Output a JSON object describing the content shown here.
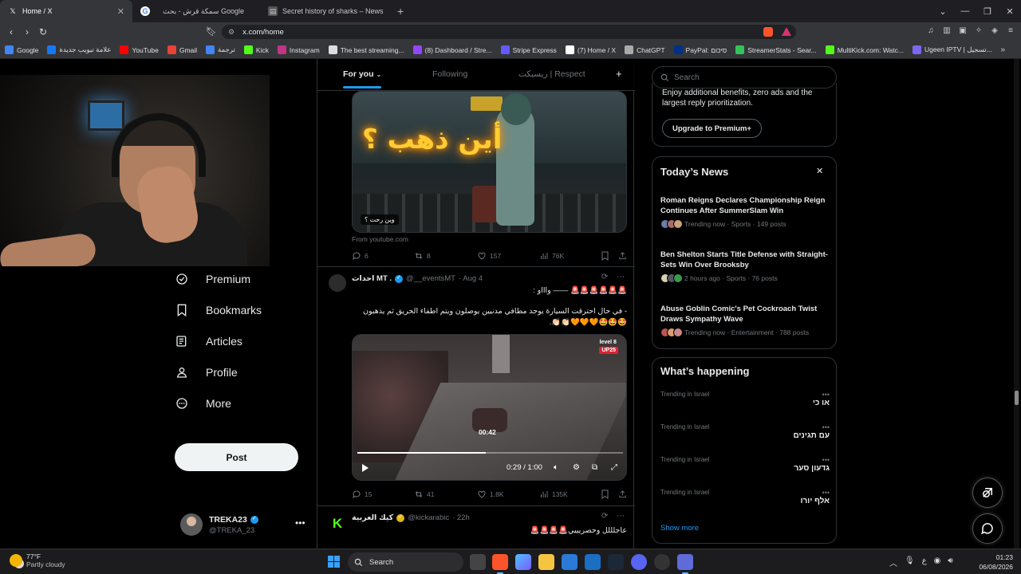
{
  "browser": {
    "tabs": [
      {
        "title": "Home / X",
        "active": true
      },
      {
        "title": "سمكة قرش - بحث Google",
        "active": false
      },
      {
        "title": "Secret history of sharks – News",
        "active": false
      }
    ],
    "url": "x.com/home",
    "bookmarks": [
      {
        "label": "Google",
        "color": "#4285f4"
      },
      {
        "label": "علامة تبويب جديدة",
        "color": "#1877f2"
      },
      {
        "label": "YouTube",
        "color": "#ff0000"
      },
      {
        "label": "Gmail",
        "color": "#ea4335"
      },
      {
        "label": "ترجمة",
        "color": "#4285f4"
      },
      {
        "label": "Kick",
        "color": "#53fc18"
      },
      {
        "label": "Instagram",
        "color": "#c13584"
      },
      {
        "label": "The best streaming...",
        "color": "#dddddd"
      },
      {
        "label": "(8) Dashboard / Stre...",
        "color": "#9147ff"
      },
      {
        "label": "Stripe Express",
        "color": "#635bff"
      },
      {
        "label": "(7) Home / X",
        "color": "#ffffff"
      },
      {
        "label": "ChatGPT",
        "color": "#aaaaaa"
      },
      {
        "label": "PayPal: סיכום",
        "color": "#003087"
      },
      {
        "label": "StreamerStats - Sear...",
        "color": "#36c25a"
      },
      {
        "label": "MultiKick.com: Watc...",
        "color": "#53fc18"
      },
      {
        "label": "Ugeen IPTV | تسجيل...",
        "color": "#7b68ee"
      }
    ]
  },
  "nav": {
    "items": [
      {
        "label": "Premium",
        "icon": "premium-icon"
      },
      {
        "label": "Bookmarks",
        "icon": "bookmark-icon"
      },
      {
        "label": "Articles",
        "icon": "articles-icon"
      },
      {
        "label": "Profile",
        "icon": "profile-icon"
      },
      {
        "label": "More",
        "icon": "more-icon"
      }
    ],
    "post_label": "Post",
    "account": {
      "name": "TREKA23",
      "handle": "@TREKA_23"
    }
  },
  "timeline": {
    "tabs": {
      "for_you": "For you",
      "following": "Following",
      "list": "ريسبكت | Respect"
    },
    "tweet1": {
      "media_text": "أين ذهب ؟",
      "media_caption": "وين رحت ؟",
      "source": "From youtube.com",
      "replies": "6",
      "reposts": "8",
      "likes": "157",
      "views": "76K"
    },
    "tweet2": {
      "name": "احداث MT .",
      "handle": "@__eventsMT",
      "date": "· Aug 4",
      "line1": "🚨🚨🚨🚨🚨🚨 —— واااو :",
      "line2": "- في حال احترقت السيارة يوجد مطافي مدنيين يوصلون ويتم اطفاء الحريق ثم يذهبون 🤩🤩🤩🧡🧡🧡👏🏻👏🏻.",
      "video_badge": "level 8",
      "video_badge2": "UP25",
      "video_timer": "00:42",
      "video_time": "0:29 / 1:00",
      "video_progress": 0.483,
      "replies": "15",
      "reposts": "41",
      "likes": "1.8K",
      "views": "135K"
    },
    "tweet3": {
      "name": "كيك العربية",
      "handle": "@kickarabic",
      "date": "· 22h",
      "text": "عاجلللل وحصريييي🚨🚨🚨🚨"
    }
  },
  "sidebar": {
    "search_placeholder": "Search",
    "premium": {
      "text": "Enjoy additional benefits, zero ads and the largest reply prioritization.",
      "button": "Upgrade to Premium+"
    },
    "news": {
      "title": "Today’s News",
      "items": [
        {
          "headline": "Roman Reigns Declares Championship Reign Continues After SummerSlam Win",
          "meta": "Trending now · Sports · 149 posts"
        },
        {
          "headline": "Ben Shelton Starts Title Defense with Straight-Sets Win Over Brooksby",
          "meta": "2 hours ago · Sports · 76 posts"
        },
        {
          "headline": "Abuse Goblin Comic's Pet Cockroach Twist Draws Sympathy Wave",
          "meta": "Trending now · Entertainment · 788 posts"
        }
      ]
    },
    "happening": {
      "title": "What’s happening",
      "trends": [
        {
          "context": "Trending in Israel",
          "term": "או כי"
        },
        {
          "context": "Trending in Israel",
          "term": "עם תגינים"
        },
        {
          "context": "Trending in Israel",
          "term": "גדעון סער"
        },
        {
          "context": "Trending in Israel",
          "term": "אלף יורו"
        }
      ],
      "show_more": "Show more"
    }
  },
  "taskbar": {
    "weather_temp": "77°F",
    "weather_desc": "Partly cloudy",
    "search": "Search",
    "time": "01:23",
    "date": "06/08/2026"
  }
}
